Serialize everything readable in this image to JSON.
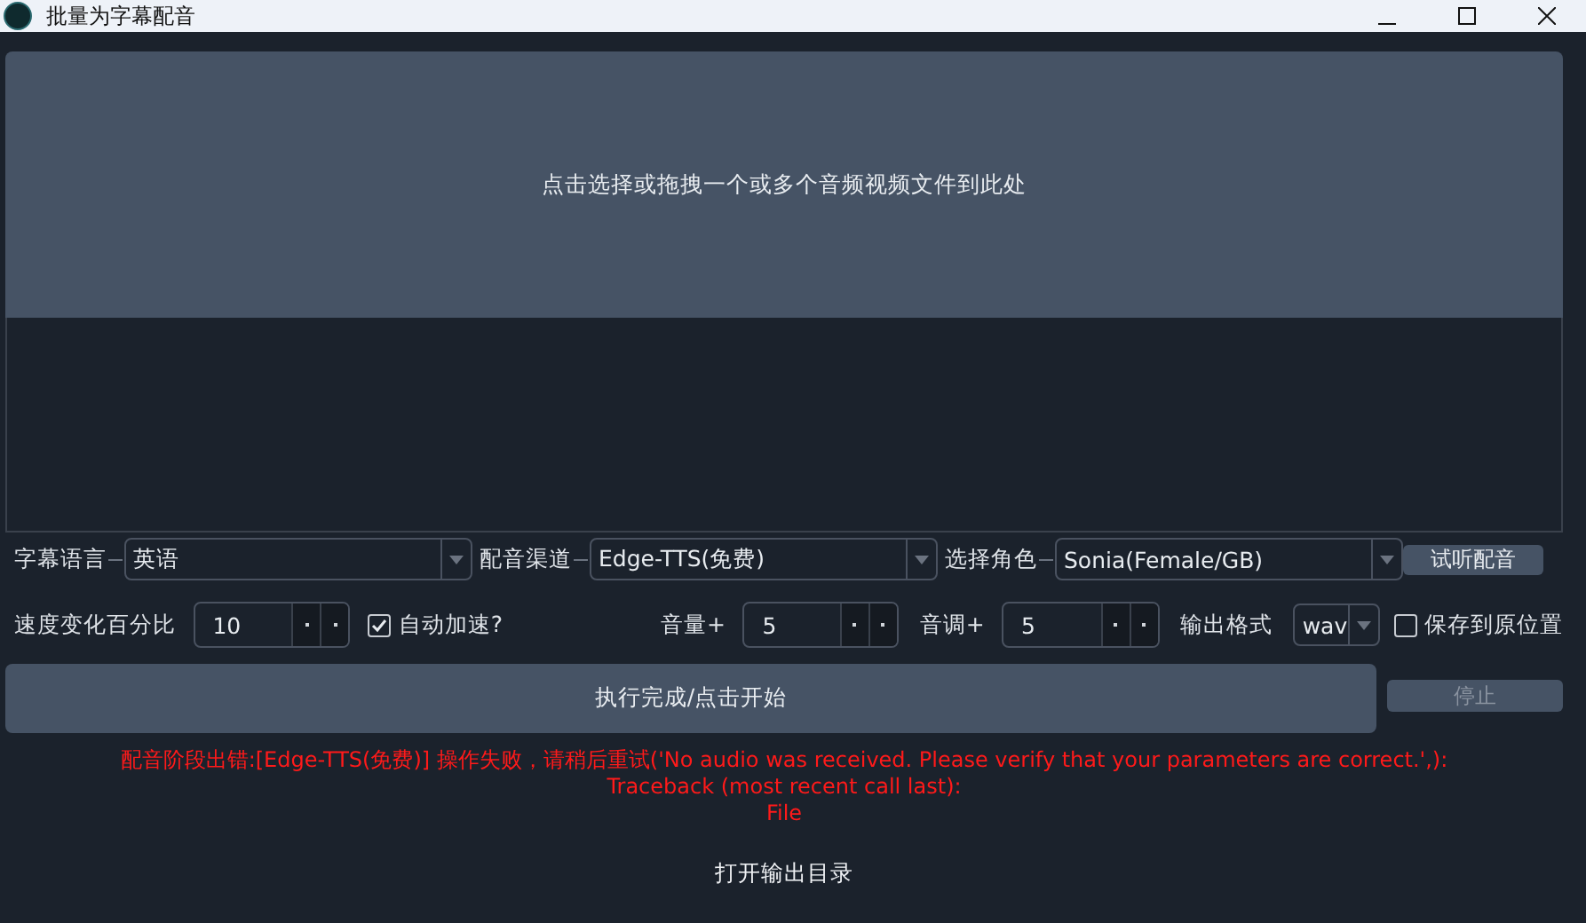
{
  "window": {
    "title": "批量为字幕配音"
  },
  "drop_zone": {
    "text": "点击选择或拖拽一个或多个音频视频文件到此处"
  },
  "row_1": [
    {
      "kind": "combo",
      "label": "字幕语言",
      "value": "英语"
    },
    {
      "kind": "combo",
      "label": "配音渠道",
      "value": "Edge-TTS(免费)"
    },
    {
      "kind": "combo",
      "label": "选择角色",
      "value": "Sonia(Female/GB)"
    },
    {
      "kind": "button",
      "text": "试听配音"
    }
  ],
  "row_2": [
    {
      "kind": "spin",
      "label": "速度变化百分比",
      "value": "10"
    },
    {
      "kind": "checkbox",
      "label": "自动加速?",
      "checked": true
    },
    {
      "kind": "spin",
      "label": "音量+",
      "value": "5"
    },
    {
      "kind": "spin",
      "label": "音调+",
      "value": "5"
    },
    {
      "kind": "combo",
      "label": "输出格式",
      "value": "wav"
    },
    {
      "kind": "checkbox",
      "label": "保存到原位置",
      "checked": false
    }
  ],
  "start_button": {
    "text": "执行完成/点击开始"
  },
  "stop_button": {
    "text": "停止",
    "disabled": true
  },
  "log_lines": [
    "配音阶段出错:[Edge-TTS(免费)] 操作失败，请稍后重试('No audio was received. Please verify that your parameters are correct.',):",
    "Traceback (most recent call last):",
    "File"
  ],
  "open_output_button": {
    "text": "打开输出目录"
  }
}
